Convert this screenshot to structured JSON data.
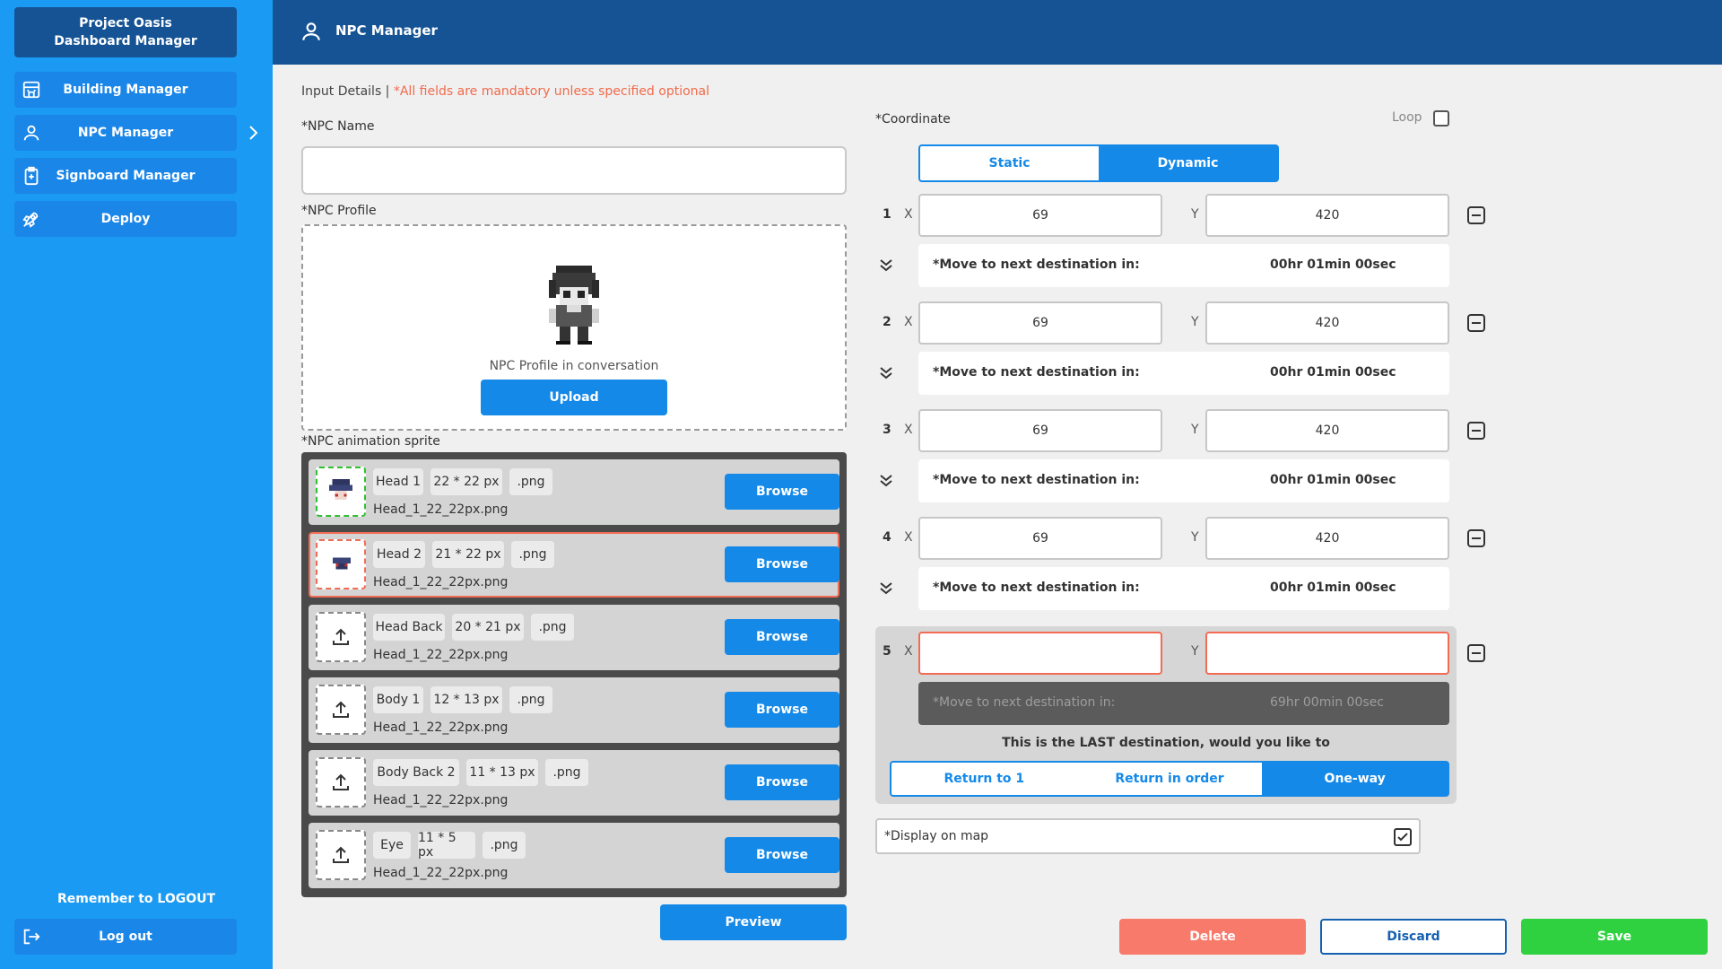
{
  "sidebar": {
    "brand_line1": "Project Oasis",
    "brand_line2": "Dashboard Manager",
    "items": [
      {
        "label": "Building Manager",
        "icon": "building-icon"
      },
      {
        "label": "NPC Manager",
        "icon": "person-icon"
      },
      {
        "label": "Signboard Manager",
        "icon": "signboard-icon"
      },
      {
        "label": "Deploy",
        "icon": "rocket-icon"
      }
    ],
    "remember": "Remember to LOGOUT",
    "logout_label": "Log out"
  },
  "header": {
    "title": "NPC Manager"
  },
  "form": {
    "input_details": "Input Details |",
    "mandatory_note": "*All fields are mandatory unless specified optional",
    "npc_name_label": "*NPC Name",
    "npc_name_value": "",
    "npc_profile_label": "*NPC Profile",
    "profile_caption": "NPC Profile in conversation",
    "upload_label": "Upload",
    "sprite_label": "*NPC animation sprite",
    "preview_label": "Preview",
    "browse_label": "Browse",
    "sprites": [
      {
        "name": "Head 1",
        "size": "22 * 22 px",
        "ext": ".png",
        "file": "Head_1_22_22px.png",
        "state": "ok"
      },
      {
        "name": "Head 2",
        "size": "21 * 22 px",
        "ext": ".png",
        "file": "Head_1_22_22px.png",
        "state": "error"
      },
      {
        "name": "Head Back",
        "size": "20 * 21 px",
        "ext": ".png",
        "file": "Head_1_22_22px.png",
        "state": "empty"
      },
      {
        "name": "Body 1",
        "size": "12 * 13 px",
        "ext": ".png",
        "file": "Head_1_22_22px.png",
        "state": "empty"
      },
      {
        "name": "Body Back 2",
        "size": "11 * 13 px",
        "ext": ".png",
        "file": "Head_1_22_22px.png",
        "state": "empty"
      },
      {
        "name": "Eye",
        "size": "11 * 5 px",
        "ext": ".png",
        "file": "Head_1_22_22px.png",
        "state": "empty"
      }
    ]
  },
  "coordinate": {
    "label": "*Coordinate",
    "loop_label": "Loop",
    "loop_checked": false,
    "modes": [
      "Static",
      "Dynamic"
    ],
    "active_mode": "Dynamic",
    "x_label": "X",
    "y_label": "Y",
    "move_label": "*Move to next destination in:",
    "points": [
      {
        "index": "1",
        "x": "69",
        "y": "420",
        "move": "00hr 01min 00sec"
      },
      {
        "index": "2",
        "x": "69",
        "y": "420",
        "move": "00hr 01min 00sec"
      },
      {
        "index": "3",
        "x": "69",
        "y": "420",
        "move": "00hr 01min 00sec"
      },
      {
        "index": "4",
        "x": "69",
        "y": "420",
        "move": "00hr 01min 00sec"
      },
      {
        "index": "5",
        "x": "",
        "y": "",
        "move": "69hr 00min 00sec"
      }
    ],
    "last_text": "This is the LAST destination, would you like to",
    "return_options": [
      "Return to 1",
      "Return in order",
      "One-way"
    ],
    "active_return": "One-way",
    "display_on_map": "*Display on map",
    "display_on_map_checked": true
  },
  "actions": {
    "delete": "Delete",
    "discard": "Discard",
    "save": "Save"
  },
  "colors": {
    "sidebar": "#1a9af3",
    "header": "#155394",
    "accent": "#1489e8",
    "delete": "#f87a6b",
    "save": "#2fd141",
    "error": "#f26b54"
  }
}
